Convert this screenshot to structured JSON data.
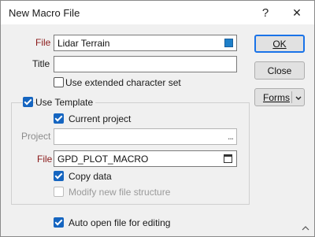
{
  "window": {
    "title": "New Macro File",
    "help_glyph": "?",
    "close_glyph": "✕"
  },
  "file": {
    "label": "File",
    "value": "Lidar Terrain",
    "icon": "color-picker-square-icon"
  },
  "title_field": {
    "label": "Title",
    "value": ""
  },
  "extended_charset": {
    "label": "Use extended character set",
    "checked": false
  },
  "template": {
    "label": "Use Template",
    "checked": true,
    "current_project": {
      "label": "Current project",
      "checked": true
    },
    "project": {
      "label": "Project",
      "value": "",
      "browse_glyph": "...",
      "disabled": true
    },
    "file": {
      "label": "File",
      "value": "GPD_PLOT_MACRO",
      "icon": "file-browse-icon"
    },
    "copy_data": {
      "label": "Copy data",
      "checked": true
    },
    "modify_structure": {
      "label": "Modify new file structure",
      "checked": false,
      "disabled": true
    }
  },
  "auto_open": {
    "label": "Auto open file for editing",
    "checked": true
  },
  "buttons": {
    "ok": "OK",
    "close": "Close",
    "forms": "Forms"
  },
  "colors": {
    "accent": "#1565c0",
    "required_label": "#8b1a1a",
    "default_button_border": "#1a73e8"
  }
}
